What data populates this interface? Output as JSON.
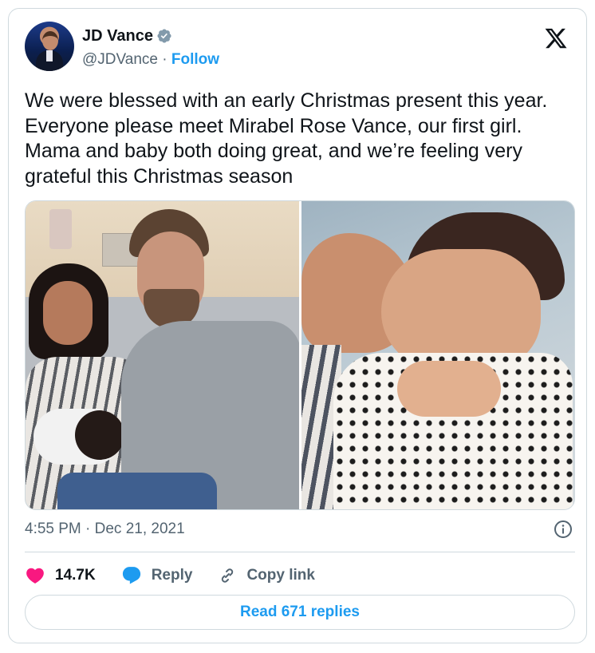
{
  "author": {
    "name": "JD Vance",
    "handle": "@JDVance",
    "separator": "·",
    "follow_label": "Follow"
  },
  "tweet": {
    "text": "We were blessed with an early Christmas present this year. Everyone please meet Mirabel Rose Vance, our first girl. Mama and baby both doing great, and we’re feeling very grateful this Christmas season",
    "time": "4:55 PM · Dec 21, 2021"
  },
  "actions": {
    "likes": "14.7K",
    "reply_label": "Reply",
    "copy_link_label": "Copy link"
  },
  "read_replies_label": "Read 671 replies",
  "icons": {
    "verified": "verified-badge-icon",
    "x_logo": "x-logo-icon",
    "info": "info-icon",
    "heart": "heart-icon",
    "reply": "reply-bubble-icon",
    "link": "link-icon"
  },
  "colors": {
    "accent": "#1d9bf0",
    "like": "#f91880",
    "text": "#0f1419",
    "secondary": "#536471",
    "border": "#cfd9de"
  }
}
